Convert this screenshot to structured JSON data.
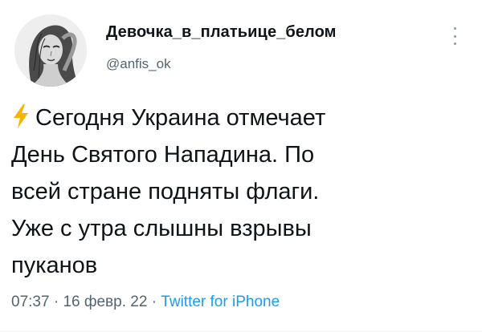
{
  "tweet": {
    "author": {
      "display_name": "Девочка_в_платьице_белом",
      "handle": "@anfis_ok"
    },
    "body_lines": [
      "Сегодня Украина отмечает",
      "День Святого Нападина. По",
      "всей стране подняты флаги.",
      "Уже с утра слышны взрывы",
      "пуканов"
    ],
    "meta": {
      "time": "07:37",
      "separator": "·",
      "date": "16 февр. 22",
      "source": "Twitter for iPhone"
    },
    "icons": {
      "lead_emoji": "high-voltage-icon",
      "menu": "more-vertical-icon"
    },
    "colors": {
      "text": "#0f1419",
      "secondary": "#536471",
      "link": "#1d9bf0",
      "bolt": "#f5b400"
    }
  }
}
